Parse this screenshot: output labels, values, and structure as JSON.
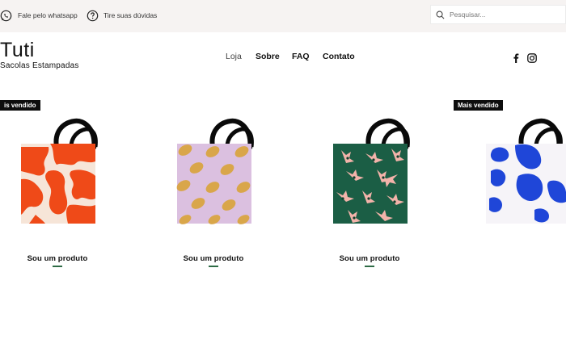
{
  "topbar": {
    "whatsapp_label": "Fale pelo whatsapp",
    "help_label": "Tire suas dúvidas",
    "search_placeholder": "Pesquisar..."
  },
  "brand": {
    "name": "Tuti",
    "tagline": "Sacolas Estampadas"
  },
  "nav": {
    "items": [
      "Loja",
      "Sobre",
      "FAQ",
      "Contato"
    ],
    "active": "Loja"
  },
  "social": [
    "facebook-icon",
    "instagram-icon"
  ],
  "products": [
    {
      "badge": "is vendido",
      "name": "Sou um produto",
      "pattern": "orange-strokes",
      "colors": [
        "#ef4a18",
        "#f6e5d8"
      ]
    },
    {
      "badge": "",
      "name": "Sou um produto",
      "pattern": "yellow-lemons",
      "colors": [
        "#d9b8df",
        "#d9a64a"
      ]
    },
    {
      "badge": "",
      "name": "Sou um produto",
      "pattern": "pink-hands",
      "colors": [
        "#1b5e45",
        "#f3b3aa"
      ]
    },
    {
      "badge": "Mais vendido",
      "name": "",
      "pattern": "blue-blobs",
      "colors": [
        "#f6f4f8",
        "#1f46d8"
      ]
    }
  ],
  "colors": {
    "topbar_bg": "#f6f3f2",
    "badge_bg": "#0d0d0d",
    "underline": "#2e6b45"
  }
}
